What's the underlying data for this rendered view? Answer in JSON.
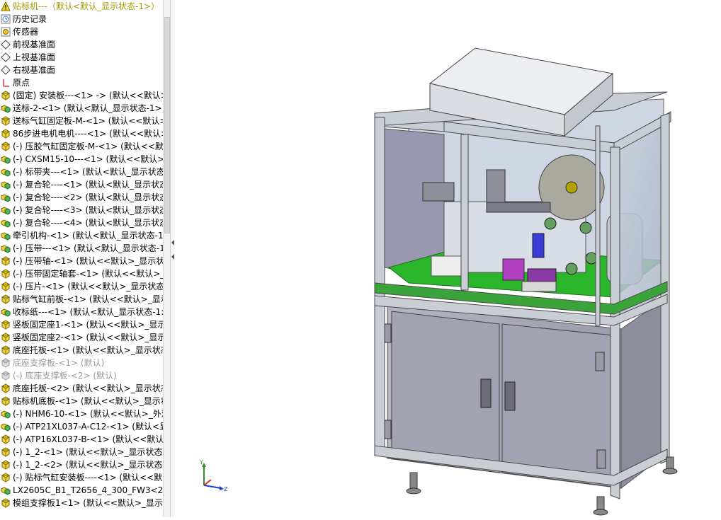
{
  "feature_tree": {
    "items": [
      {
        "label": "贴标机---（默认<默认_显示状态-1>）",
        "icon": "warning-icon",
        "state": "warn"
      },
      {
        "label": "历史记录",
        "icon": "history-icon",
        "state": "normal"
      },
      {
        "label": "传感器",
        "icon": "sensor-icon",
        "state": "normal"
      },
      {
        "label": "前视基准面",
        "icon": "plane-icon",
        "state": "normal"
      },
      {
        "label": "上视基准面",
        "icon": "plane-icon",
        "state": "normal"
      },
      {
        "label": "右视基准面",
        "icon": "plane-icon",
        "state": "normal"
      },
      {
        "label": "原点",
        "icon": "origin-icon",
        "state": "normal"
      },
      {
        "label": "(固定) 安装板---<1> -> (默认<<默认>",
        "icon": "part-icon",
        "state": "normal"
      },
      {
        "label": "送标-2-<1> (默认<默认_显示状态-1>)",
        "icon": "assembly-icon",
        "state": "normal"
      },
      {
        "label": "送标气缸固定板-M-<1> (默认<<默认>",
        "icon": "part-icon",
        "state": "normal"
      },
      {
        "label": "86步进电机电机----<1> (默认<<默认>",
        "icon": "part-icon",
        "state": "normal"
      },
      {
        "label": "(-) 压胶气缸固定板-M-<1> (默认<<默",
        "icon": "part-icon",
        "state": "normal"
      },
      {
        "label": "(-) CXSM15-10---<1> (默认<<默认>",
        "icon": "assembly-icon",
        "state": "normal"
      },
      {
        "label": "(-) 标带夹---<1> (默认<默认_显示状态",
        "icon": "assembly-icon",
        "state": "normal"
      },
      {
        "label": "(-) 复合轮----<1> (默认<默认_显示状态",
        "icon": "assembly-icon",
        "state": "normal"
      },
      {
        "label": "(-) 复合轮----<2> (默认<默认_显示状态",
        "icon": "assembly-icon",
        "state": "normal"
      },
      {
        "label": "(-) 复合轮----<3> (默认<默认_显示状态",
        "icon": "assembly-icon",
        "state": "normal"
      },
      {
        "label": "(-) 复合轮----<4> (默认<默认_显示状态",
        "icon": "assembly-icon",
        "state": "normal"
      },
      {
        "label": "牵引机构-<1> (默认<默认_显示状态-1",
        "icon": "assembly-icon",
        "state": "normal"
      },
      {
        "label": "(-) 压带---<1> (默认<默认_显示状态-1",
        "icon": "assembly-icon",
        "state": "normal"
      },
      {
        "label": "(-) 压带轴-<1> (默认<<默认>_显示状",
        "icon": "part-icon",
        "state": "normal"
      },
      {
        "label": "(-) 压带固定轴套-<1> (默认<<默认>_",
        "icon": "part-icon",
        "state": "normal"
      },
      {
        "label": "(-) 压片-<1> (默认<<默认>_显示状态",
        "icon": "part-icon",
        "state": "normal"
      },
      {
        "label": "贴标气缸前板-<1> (默认<<默认>_显示",
        "icon": "part-icon",
        "state": "normal"
      },
      {
        "label": "收标纸---<1> (默认<默认_显示状态-1:",
        "icon": "assembly-icon",
        "state": "normal"
      },
      {
        "label": "竖板固定座1-<1> (默认<<默认>_显示",
        "icon": "part-icon",
        "state": "normal"
      },
      {
        "label": "竖板固定座2-<1> (默认<<默认>_显示",
        "icon": "part-icon",
        "state": "normal"
      },
      {
        "label": "底座托板-<1> (默认<<默认>_显示状态",
        "icon": "part-icon",
        "state": "normal"
      },
      {
        "label": "底座支撑板-<1> (默认)",
        "icon": "part-suppressed-icon",
        "state": "suppressed"
      },
      {
        "label": "(-) 底座支撑板-<2> (默认)",
        "icon": "part-suppressed-icon",
        "state": "suppressed"
      },
      {
        "label": "底座托板-<2> (默认<<默认>_显示状态",
        "icon": "part-icon",
        "state": "normal"
      },
      {
        "label": "贴标机底板-<1> (默认<<默认>_显示状",
        "icon": "part-icon",
        "state": "normal"
      },
      {
        "label": "(-) NHM6-10-<1> (默认<<默认>_外观",
        "icon": "assembly-icon",
        "state": "normal"
      },
      {
        "label": "(-) ATP21XL037-A-C12-<1> (默认<显",
        "icon": "assembly-icon",
        "state": "normal"
      },
      {
        "label": "(-) ATP16XL037-B-<1> (默认<<默认>",
        "icon": "part-icon",
        "state": "normal"
      },
      {
        "label": "(-) 1_2-<1> (默认<<默认>_显示状态 1",
        "icon": "part-icon",
        "state": "normal"
      },
      {
        "label": "(-) 1_2-<2> (默认<<默认>_显示状态 1",
        "icon": "part-icon",
        "state": "normal"
      },
      {
        "label": "(-) 贴标气缸安装板----<1> (默认<<默",
        "icon": "part-icon",
        "state": "normal"
      },
      {
        "label": "LX2605C_B1_T2656_4_300_FW3<2> (",
        "icon": "assembly-icon",
        "state": "normal"
      },
      {
        "label": "模组支撑板1<1> (默认<<默认>_显示状",
        "icon": "part-icon",
        "state": "normal"
      }
    ]
  },
  "viewport": {
    "triad": {
      "x_label": "X",
      "y_label": "Y",
      "z_label": "Z"
    }
  },
  "colors": {
    "frame": "#c9cdd4",
    "panel": "#a8a8b8",
    "glass": "#b8c4d8",
    "green_plate": "#2bb52b",
    "top_box": "#dcdde2",
    "warning": "#a69a00",
    "suppressed": "#9a9a9a"
  }
}
